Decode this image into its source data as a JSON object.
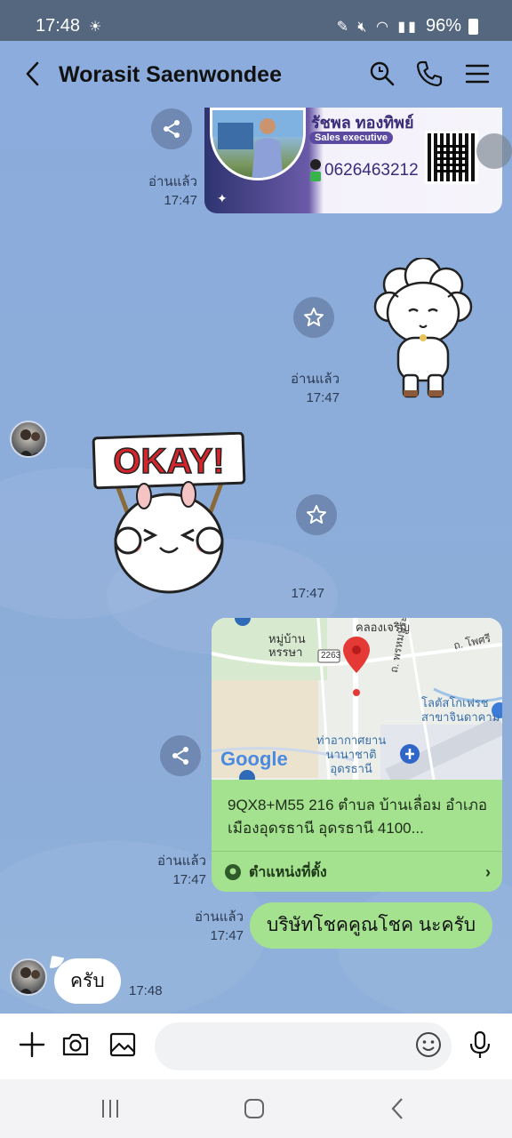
{
  "status_bar": {
    "time": "17:48",
    "battery": "96%"
  },
  "header": {
    "contact_name": "Worasit Saenwondee"
  },
  "messages": {
    "card": {
      "name": "รัชพล ทองทิพย์",
      "role": "Sales executive",
      "phone": "0626463212",
      "read": "อ่านแล้ว",
      "time": "17:47"
    },
    "sticker_sheep": {
      "read": "อ่านแล้ว",
      "time": "17:47"
    },
    "sticker_okay": {
      "text": "OKAY!",
      "time": "17:47"
    },
    "location": {
      "map_labels": {
        "village": "หมู่บ้าน\nหรรษา",
        "road_sign": "2263",
        "klong": "คลองเจริญ",
        "road_phot": "ถ. โพศรี",
        "road_phrom": "ถ. พรหมประกาศ",
        "lotus": "โลตัสโกเฟรช\nสาขาจินดาคาม",
        "airport": "ท่าอากาศยาน\nนานาชาติ\nอุดรธานี",
        "google": "Google"
      },
      "address": "9QX8+M55 216 ตำบล บ้านเลื่อม อำเภอเมืองอุดรธานี อุดรธานี 4100...",
      "link_label": "ตำแหน่งที่ตั้ง",
      "read": "อ่านแล้ว",
      "time": "17:47"
    },
    "outgoing_text": {
      "text": "บริษัทโชคคูณโชค นะครับ",
      "read": "อ่านแล้ว",
      "time": "17:47"
    },
    "incoming_text": {
      "text": "ครับ",
      "time": "17:48"
    }
  },
  "input": {
    "placeholder": ""
  },
  "icons": {
    "back": "chevron-left-icon",
    "search": "search-icon",
    "call": "phone-icon",
    "menu": "menu-icon",
    "share": "share-icon",
    "favorite": "star-icon",
    "add": "plus-icon",
    "camera": "camera-icon",
    "gallery": "image-icon",
    "emoji": "emoji-icon",
    "mic": "microphone-icon"
  },
  "colors": {
    "chat_bg": "#8eaed8",
    "outgoing_bubble": "#a4e28f",
    "incoming_bubble": "#ffffff",
    "status_bar": "#55677e"
  }
}
